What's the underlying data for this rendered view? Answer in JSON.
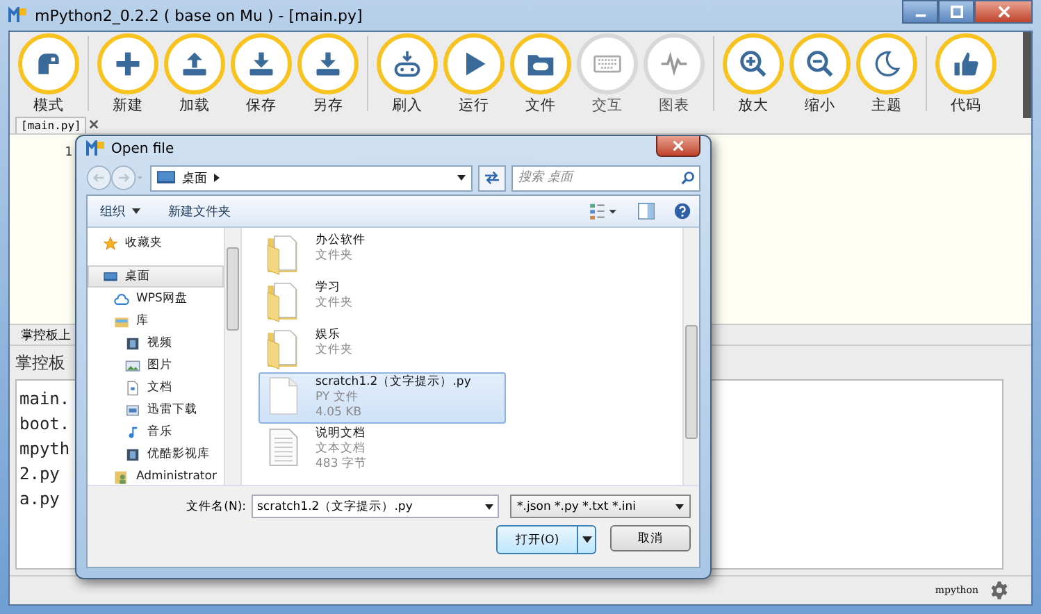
{
  "window": {
    "title": "mPython2_0.2.2 ( base on Mu ) - [main.py]"
  },
  "toolbar_groups": [
    {
      "buttons": [
        {
          "kind": "mode",
          "label": "模式",
          "disabled": false
        }
      ]
    },
    {
      "buttons": [
        {
          "kind": "new",
          "label": "新建",
          "disabled": false
        },
        {
          "kind": "load",
          "label": "加载",
          "disabled": false
        },
        {
          "kind": "save",
          "label": "保存",
          "disabled": false
        },
        {
          "kind": "saveas",
          "label": "另存",
          "disabled": false
        }
      ]
    },
    {
      "buttons": [
        {
          "kind": "flash",
          "label": "刷入",
          "disabled": false
        },
        {
          "kind": "run",
          "label": "运行",
          "disabled": false
        },
        {
          "kind": "files",
          "label": "文件",
          "disabled": false
        },
        {
          "kind": "repl",
          "label": "交互",
          "disabled": true
        },
        {
          "kind": "plotter",
          "label": "图表",
          "disabled": true
        }
      ]
    },
    {
      "buttons": [
        {
          "kind": "zoomin",
          "label": "放大",
          "disabled": false
        },
        {
          "kind": "zoomout",
          "label": "缩小",
          "disabled": false
        },
        {
          "kind": "theme",
          "label": "主题",
          "disabled": false
        }
      ]
    },
    {
      "buttons": [
        {
          "kind": "code",
          "label": "代码",
          "disabled": false
        }
      ]
    }
  ],
  "editor": {
    "tab": "[main.py]",
    "line_numbers": [
      "1"
    ]
  },
  "panel": {
    "tab": "掌控板上",
    "heading": "掌控板",
    "files": [
      "main.",
      "boot.",
      "mpyth",
      "2.py",
      "a.py"
    ]
  },
  "status_bar": {
    "mode": "mpython"
  },
  "dialog": {
    "title": "Open file",
    "path": "桌面",
    "search": {
      "placeholder": "搜索 桌面"
    },
    "commands": [
      {
        "kind": "menu",
        "label": "组织"
      },
      {
        "kind": "plain",
        "label": "新建文件夹"
      }
    ],
    "nav": [
      {
        "kind": "star",
        "label": "收藏夹",
        "selected": false
      },
      {
        "kind": "desktop",
        "label": "桌面",
        "selected": true,
        "children": [
          {
            "kind": "cloud",
            "label": "WPS网盘",
            "selected": false
          },
          {
            "kind": "library",
            "label": "库",
            "selected": false,
            "children": [
              {
                "kind": "video",
                "label": "视频",
                "selected": false
              },
              {
                "kind": "picture",
                "label": "图片",
                "selected": false
              },
              {
                "kind": "doc",
                "label": "文档",
                "selected": false
              },
              {
                "kind": "download",
                "label": "迅雷下载",
                "selected": false
              },
              {
                "kind": "music",
                "label": "音乐",
                "selected": false
              },
              {
                "kind": "video",
                "label": "优酷影视库",
                "selected": false
              }
            ]
          },
          {
            "kind": "user",
            "label": "Administrator",
            "selected": false
          }
        ]
      }
    ],
    "files": [
      {
        "kind": "folder",
        "name": "办公软件",
        "type": "文件夹",
        "selected": false
      },
      {
        "kind": "folder",
        "name": "学习",
        "type": "文件夹",
        "selected": false
      },
      {
        "kind": "folder",
        "name": "娱乐",
        "type": "文件夹",
        "selected": false
      },
      {
        "kind": "file",
        "name": "scratch1.2（文字提示）.py",
        "type": "PY 文件",
        "size": "4.05 KB",
        "selected": true
      },
      {
        "kind": "text",
        "name": "说明文档",
        "type": "文本文档",
        "size": "483 字节",
        "selected": false
      }
    ],
    "filename_label": "文件名(N):",
    "filename": "scratch1.2（文字提示）.py",
    "filter": "*.json *.py *.txt *.ini",
    "buttons": [
      {
        "kind": "split",
        "label": "打开(O)"
      },
      {
        "kind": "plain",
        "label": "取消"
      }
    ]
  }
}
